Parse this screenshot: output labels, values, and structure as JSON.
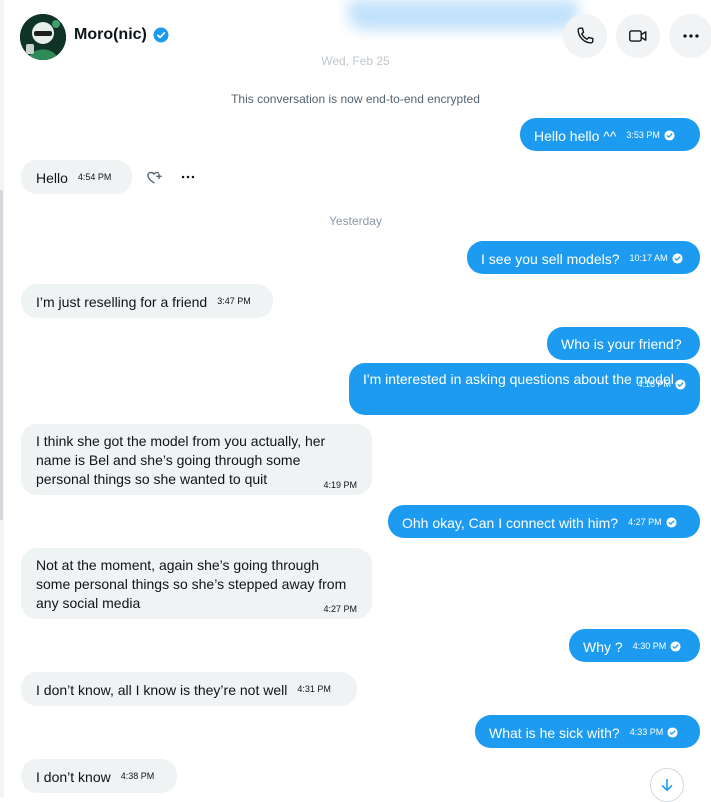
{
  "header": {
    "name": "Moro(nic)",
    "icons": {
      "verified": "verified-badge-icon",
      "phone": "phone-icon",
      "video": "video-camera-icon",
      "more": "more-horizontal-icon"
    }
  },
  "dates": {
    "first": "Wed, Feb 25",
    "second": "Yesterday"
  },
  "encryption_note": "This conversation is now end-to-end encrypted",
  "messages": [
    {
      "dir": "out",
      "text": "Hello hello ^^",
      "time": "3:53 PM"
    },
    {
      "dir": "in",
      "text": "Hello",
      "time": "4:54 PM"
    },
    {
      "dir": "out",
      "text": "I see you sell models?",
      "time": "10:17 AM"
    },
    {
      "dir": "in",
      "text": "I’m just reselling for a friend",
      "time": "3:47 PM"
    },
    {
      "dir": "out",
      "text": "Who is your friend?",
      "time": ""
    },
    {
      "dir": "out",
      "text": "I'm interested in asking questions about the model.",
      "time": "4:18 PM"
    },
    {
      "dir": "in",
      "text": "I think she got the model from you actually, her name is Bel and she’s going through some personal things so she wanted to quit",
      "time": "4:19 PM"
    },
    {
      "dir": "out",
      "text": "Ohh okay, Can I connect with him?",
      "time": "4:27 PM"
    },
    {
      "dir": "in",
      "text": "Not at the moment, again she’s going through some personal things so she’s stepped away from any social media",
      "time": "4:27 PM"
    },
    {
      "dir": "out",
      "text": "Why ?",
      "time": "4:30 PM"
    },
    {
      "dir": "in",
      "text": "I don’t know, all I know is they’re not well",
      "time": "4:31 PM"
    },
    {
      "dir": "out",
      "text": "What is he sick with?",
      "time": "4:33 PM"
    },
    {
      "dir": "in",
      "text": "I don’t know",
      "time": "4:38 PM"
    }
  ],
  "colors": {
    "outgoing_bubble": "#1d9bf0",
    "incoming_bubble": "#eff3f4",
    "verified": "#1d9bf0"
  }
}
